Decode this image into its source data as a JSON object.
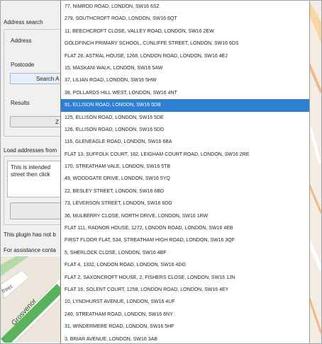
{
  "panel": {
    "address_search": "Address search",
    "address_label": "Address",
    "postcode_label": "Postcode",
    "search_button": "Search A",
    "results_label": "Results",
    "results_button": "Z",
    "load_label": "Load addresses from",
    "text_line1": "This is intended",
    "text_line2": "street then click",
    "plugin_note": "This plugin has not b",
    "assistance": "For assistance conta"
  },
  "map": {
    "street_label": "Grosvenor",
    "street_label2": "treet"
  },
  "addresses": [
    "77, NIMROD ROAD, LONDON, SW16 6SZ",
    "279, SOUTHCROFT ROAD, LONDON, SW16 6QT",
    "11, BEECHCROFT CLOSE, VALLEY ROAD, LONDON, SW16 2EW",
    "GOLDFINCH PRIMARY SCHOOL, CUNLIFFE STREET, LONDON, SW16 6DS",
    "FLAT 28, ASTRAL HOUSE, 1268, LONDON ROAD, LONDON, SW16 4EJ",
    "15, MASKANI WALK, LONDON, SW16 5AW",
    "37, LILIAN ROAD, LONDON, SW16 5HW",
    "38, POLLARDS HILL WEST, LONDON, SW16 4NT",
    "91, ELLISON ROAD, LONDON, SW16 5DB",
    "125, ELLISON ROAD, LONDON, SW16 5DE",
    "126, ELLISON ROAD, LONDON, SW16 5DD",
    "116, GLENEAGLE ROAD, LONDON, SW16 6BA",
    "FLAT 13, SUFFOLK COURT, 182, LEIGHAM COURT ROAD, LONDON, SW16 2RE",
    "170, STREATHAM VALE, LONDON, SW16 5TB",
    "49, WOODGATE DRIVE, LONDON, SW16 5YQ",
    "22, BESLEY STREET, LONDON, SW16 6BD",
    "73, LEVERSON STREET, LONDON, SW16 6DG",
    "36, MULBERRY CLOSE, NORTH DRIVE, LONDON, SW16 1RW",
    "FLAT 111, RADNOR HOUSE, 1272, LONDON ROAD, LONDON, SW16 4EB",
    "FIRST FLOOR FLAT, 534, STREATHAM HIGH ROAD, LONDON, SW16 3QF",
    "5, SHERLOCK CLOSE, LONDON, SW16 4BF",
    "FLAT 4, 1332, LONDON ROAD, LONDON, SW16 4DG",
    "FLAT 2, SAXONCROFT HOUSE, 2, FISHERS CLOSE, LONDON, SW16 1JN",
    "FLAT 16, SOLENT COURT, 1258, LONDON ROAD, LONDON, SW16 4EY",
    "10, LYNDHURST AVENUE, LONDON, SW16 4UF",
    "240, STREATHAM ROAD, LONDON, SW16 6NY",
    "31, WINDERMERE ROAD, LONDON, SW16 5HF",
    "3, BRIAR AVENUE, LONDON, SW16 3AB"
  ],
  "selected_index": 8
}
